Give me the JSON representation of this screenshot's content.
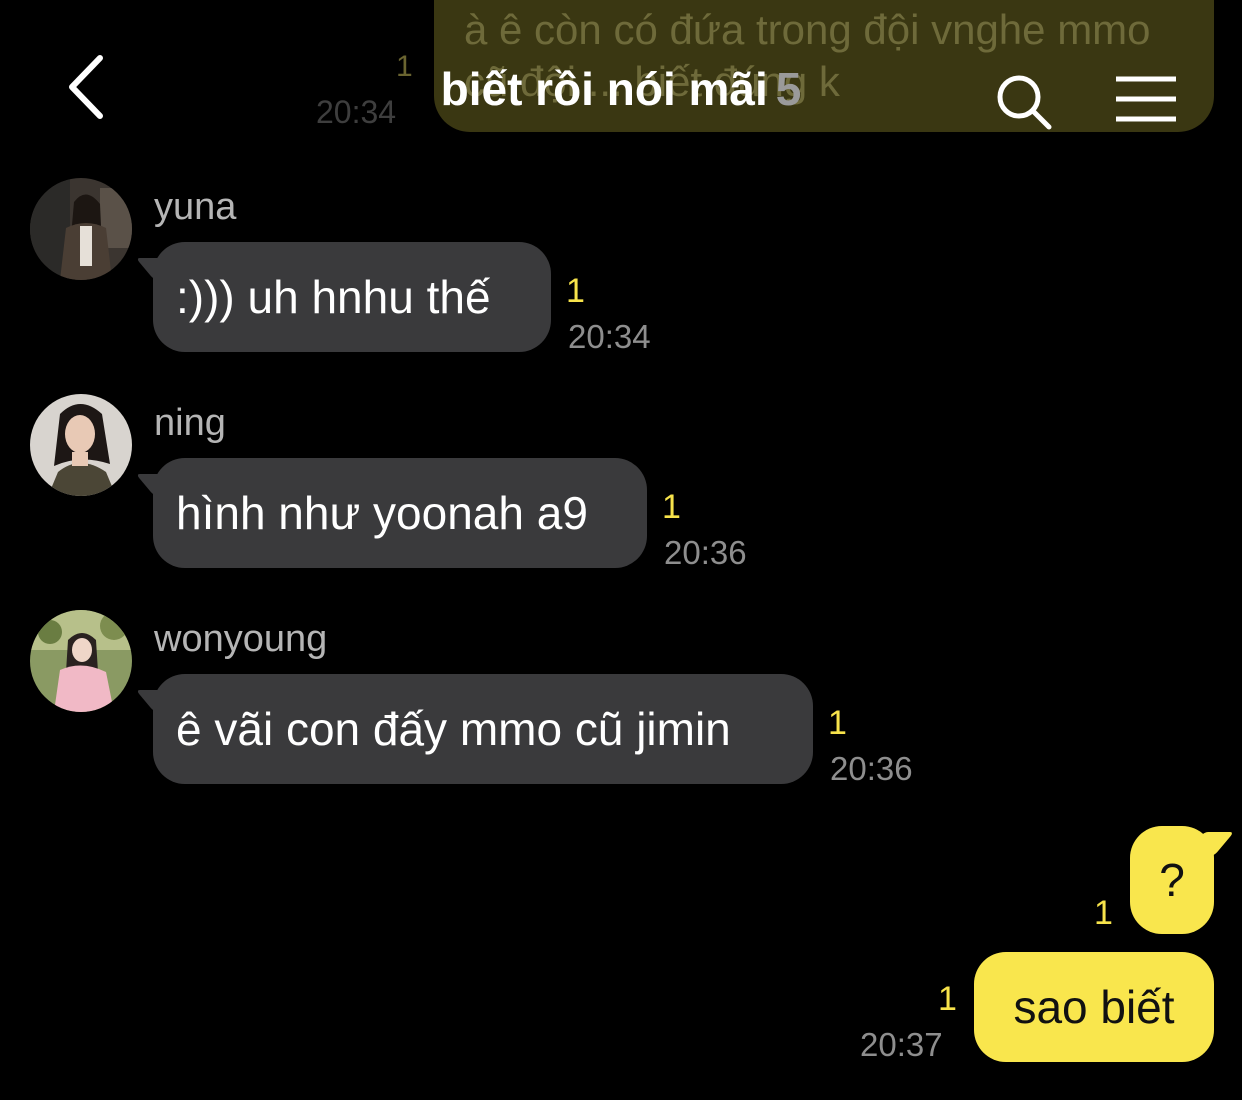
{
  "previous_message": {
    "text": "à ê còn có đứa trong đội vnghe mmo cũ đội ... biết đúng k",
    "unread": "1",
    "time": "20:34"
  },
  "header": {
    "title": "biết rồi nói mãi",
    "member_count": "5",
    "icons": {
      "back": "chevron-left-icon",
      "search": "search-icon",
      "menu": "hamburger-menu-icon"
    }
  },
  "messages": [
    {
      "sender": "yuna",
      "text": ":))) uh hnhu thế",
      "unread": "1",
      "time": "20:34"
    },
    {
      "sender": "ning",
      "text": "hình như yoonah a9",
      "unread": "1",
      "time": "20:36"
    },
    {
      "sender": "wonyoung",
      "text": "ê vãi con đấy mmo cũ jimin",
      "unread": "1",
      "time": "20:36"
    }
  ],
  "my_messages": [
    {
      "text": "?",
      "unread": "1"
    },
    {
      "text": "sao biết",
      "unread": "1",
      "time": "20:37"
    }
  ],
  "colors": {
    "background": "#000000",
    "incoming_bubble": "#3a3a3c",
    "outgoing_bubble": "#f9e64d",
    "unread": "#f7e34b"
  }
}
